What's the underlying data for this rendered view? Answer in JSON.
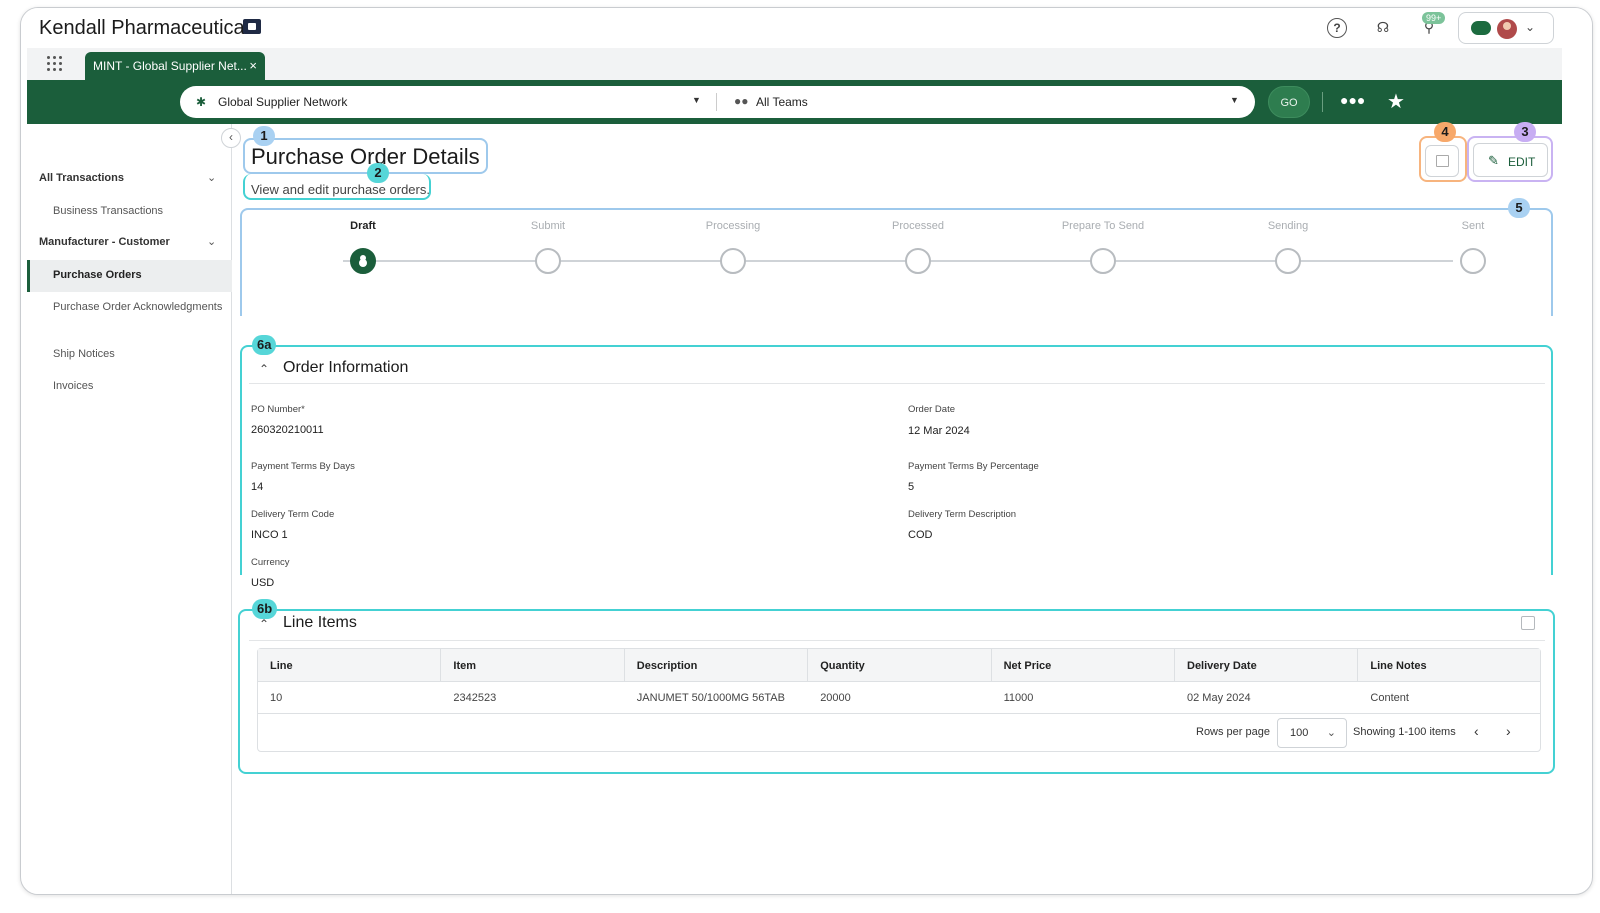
{
  "app": {
    "title": "Kendall Pharmaceuticals",
    "notifications_badge": "99+"
  },
  "tabs": [
    {
      "label": "MINT - Global Supplier Net...",
      "close": "×"
    }
  ],
  "search": {
    "network_label": "Global Supplier Network",
    "team_label": "All Teams",
    "go_label": "GO"
  },
  "sidebar": {
    "groups": [
      {
        "label": "All Transactions",
        "items": [
          "Business Transactions"
        ]
      },
      {
        "label": "Manufacturer - Customer",
        "items": [
          "Purchase Orders",
          "Purchase Order Acknowledgments",
          "Ship Notices",
          "Invoices"
        ]
      }
    ],
    "active_item": "Purchase Orders"
  },
  "page": {
    "title": "Purchase Order Details",
    "subtitle": "View and edit purchase orders.",
    "edit_label": "EDIT"
  },
  "annotations": {
    "b1": "1",
    "b2": "2",
    "b3": "3",
    "b4": "4",
    "b5": "5",
    "b6a": "6a",
    "b6b": "6b"
  },
  "stepper": {
    "current_index": 0,
    "steps": [
      "Draft",
      "Submit",
      "Processing",
      "Processed",
      "Prepare To Send",
      "Sending",
      "Sent"
    ]
  },
  "order_info": {
    "title": "Order Information",
    "fields": {
      "po_number": {
        "label": "PO Number*",
        "value": "260320210011"
      },
      "order_date": {
        "label": "Order Date",
        "value": "12 Mar 2024"
      },
      "terms_days": {
        "label": "Payment Terms By Days",
        "value": "14"
      },
      "terms_pct": {
        "label": "Payment Terms By Percentage",
        "value": "5"
      },
      "delivery_code": {
        "label": "Delivery Term Code",
        "value": "INCO 1"
      },
      "delivery_desc": {
        "label": "Delivery Term Description",
        "value": "COD"
      },
      "currency": {
        "label": "Currency",
        "value": "USD"
      }
    }
  },
  "line_items": {
    "title": "Line Items",
    "columns": [
      "Line",
      "Item",
      "Description",
      "Quantity",
      "Net Price",
      "Delivery Date",
      "Line Notes"
    ],
    "rows": [
      [
        "10",
        "2342523",
        "JANUMET 50/1000MG 56TAB",
        "20000",
        "11000",
        "02 May 2024",
        "Content"
      ]
    ],
    "pager": {
      "rows_per_page_label": "Rows per page",
      "rows_per_page": "100",
      "showing": "Showing 1-100 items"
    }
  }
}
